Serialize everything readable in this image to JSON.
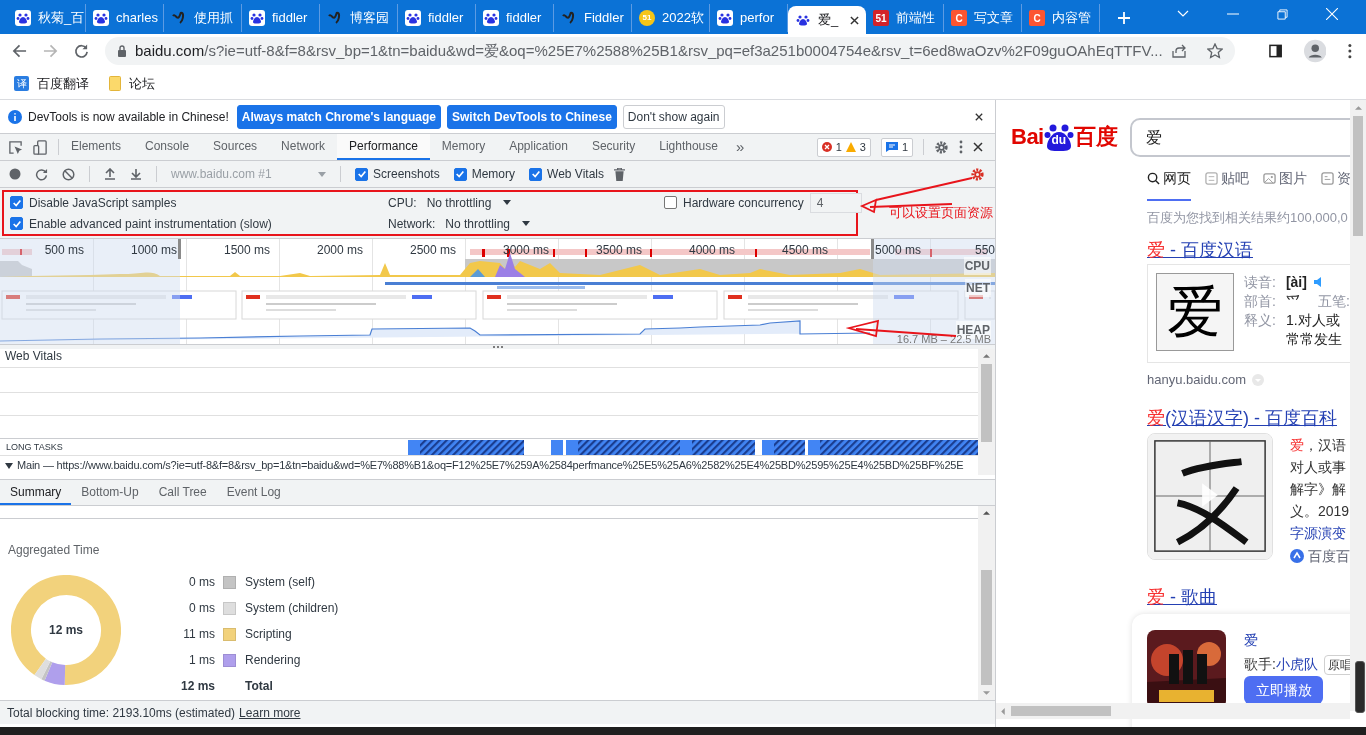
{
  "browser": {
    "tabs": [
      {
        "title": "秋菊_百",
        "kind": "paw",
        "selected": false
      },
      {
        "title": "charles",
        "kind": "paw",
        "selected": false
      },
      {
        "title": "使用抓",
        "kind": "mark",
        "selected": false
      },
      {
        "title": "fiddler",
        "kind": "paw",
        "selected": false
      },
      {
        "title": "博客园",
        "kind": "mark",
        "selected": false
      },
      {
        "title": "fiddler",
        "kind": "paw",
        "selected": false
      },
      {
        "title": "fiddler",
        "kind": "paw",
        "selected": false
      },
      {
        "title": "Fiddler",
        "kind": "mark",
        "selected": false
      },
      {
        "title": "2022软",
        "kind": "coin",
        "icon_text": "51",
        "selected": false
      },
      {
        "title": "perfor",
        "kind": "paw",
        "selected": false
      },
      {
        "title": "爱_",
        "kind": "paw",
        "selected": true
      },
      {
        "title": "前端性",
        "kind": "square",
        "icon_text": "51",
        "color": "#d2232a",
        "selected": false
      },
      {
        "title": "写文章",
        "kind": "square",
        "icon_text": "C",
        "color": "#fc5531",
        "selected": false
      },
      {
        "title": "内容管",
        "kind": "square",
        "icon_text": "C",
        "color": "#fc5531",
        "selected": false
      }
    ],
    "address": {
      "host": "baidu.com",
      "path": "/s?ie=utf-8&f=8&rsv_bp=1&tn=baidu&wd=爱&oq=%25E7%2588%25B1&rsv_pq=ef3a251b0004754e&rsv_t=6ed8waOzv%2F09guOAhEqTTFV..."
    },
    "bookmarks": [
      {
        "label": "百度翻译",
        "kind": "translate",
        "icon_text": "译"
      },
      {
        "label": "论坛",
        "kind": "folder"
      }
    ]
  },
  "devtools": {
    "infobar": {
      "message": "DevTools is now available in Chinese!",
      "buttons": [
        {
          "label": "Always match Chrome's language",
          "kind": "primary"
        },
        {
          "label": "Switch DevTools to Chinese",
          "kind": "primary"
        },
        {
          "label": "Don't show again",
          "kind": "plain"
        }
      ]
    },
    "panel_tabs": [
      {
        "label": "Elements",
        "selected": false
      },
      {
        "label": "Console",
        "selected": false
      },
      {
        "label": "Sources",
        "selected": false
      },
      {
        "label": "Network",
        "selected": false
      },
      {
        "label": "Performance",
        "selected": true
      },
      {
        "label": "Memory",
        "selected": false
      },
      {
        "label": "Application",
        "selected": false
      },
      {
        "label": "Security",
        "selected": false
      },
      {
        "label": "Lighthouse",
        "selected": false
      }
    ],
    "more_tabs": "»",
    "counts": {
      "errors": "1",
      "warnings": "3",
      "messages": "1"
    },
    "toolbar": {
      "target": "www.baidu.com #1",
      "checkboxes": [
        {
          "label": "Screenshots",
          "checked": true
        },
        {
          "label": "Memory",
          "checked": true
        },
        {
          "label": "Web Vitals",
          "checked": true
        }
      ]
    },
    "settings": {
      "checkboxes": [
        {
          "label": "Disable JavaScript samples",
          "checked": true
        },
        {
          "label": "Enable advanced paint instrumentation (slow)",
          "checked": true
        }
      ],
      "cpu": {
        "label": "CPU:",
        "value": "No throttling"
      },
      "network": {
        "label": "Network:",
        "value": "No throttling"
      },
      "hardware": {
        "label": "Hardware concurrency",
        "checked": false,
        "value": "4"
      }
    },
    "overview": {
      "ticks": [
        "500 ms",
        "1000 ms",
        "1500 ms",
        "2000 ms",
        "2500 ms",
        "3000 ms",
        "3500 ms",
        "4000 ms",
        "4500 ms",
        "5000 ms",
        "550"
      ],
      "tracks": [
        "CPU",
        "NET",
        "HEAP"
      ],
      "heap_range": "16.7 MB – 22.5 MB"
    },
    "web_vitals_label": "Web Vitals",
    "long_tasks_label": "LONG TASKS",
    "main_row": "Main — https://www.baidu.com/s?ie=utf-8&f=8&rsv_bp=1&tn=baidu&wd=%E7%88%B1&oq=F12%25E7%259A%2584perfmance%25E5%25A6%2582%25E4%25BD%2595%25E4%25BD%25BF%25E",
    "bottom_tabs": [
      {
        "label": "Summary",
        "selected": true
      },
      {
        "label": "Bottom-Up",
        "selected": false
      },
      {
        "label": "Call Tree",
        "selected": false
      },
      {
        "label": "Event Log",
        "selected": false
      }
    ],
    "summary": {
      "title": "Aggregated Time",
      "center": "12 ms",
      "legend": [
        {
          "value": "0 ms",
          "label": "System (self)",
          "color": "#c4c4c4"
        },
        {
          "value": "0 ms",
          "label": "System (children)",
          "color": "#dedede"
        },
        {
          "value": "11 ms",
          "label": "Scripting",
          "color": "#f2d27c"
        },
        {
          "value": "1 ms",
          "label": "Rendering",
          "color": "#af9fec"
        }
      ],
      "total": {
        "value": "12 ms",
        "label": "Total"
      }
    },
    "status": {
      "text": "Total blocking time: 2193.10ms (estimated)",
      "link": "Learn more"
    }
  },
  "annotation": {
    "note": "可以设置页面资源"
  },
  "page": {
    "logo": {
      "left": "Bai",
      "paw": "du",
      "right": "百度"
    },
    "search_value": "爱",
    "nav": [
      {
        "label": "网页",
        "selected": true
      },
      {
        "label": "贴吧",
        "selected": false
      },
      {
        "label": "图片",
        "selected": false
      },
      {
        "label": "资",
        "selected": false
      }
    ],
    "result_count": "百度为您找到相关结果约100,000,0",
    "results": [
      {
        "kind": "dict",
        "title_hl": "爱",
        "title_rest": " - 百度汉语",
        "char": "爱",
        "rows": [
          {
            "label": "读音:",
            "value": "[ài]"
          },
          {
            "label": "部首:",
            "value": "爫"
          },
          {
            "label": "释义:",
            "value": "1.对人或"
          }
        ],
        "extra_label": "五笔:",
        "extra_line": "常常发生",
        "source": "hanyu.baidu.com"
      },
      {
        "kind": "baike",
        "title_hl": "爱",
        "title_rest": "(汉语汉字) - 百度百科",
        "lines": [
          {
            "hl": "爱",
            "text": "，汉语"
          },
          {
            "text": "对人或事"
          },
          {
            "text": "解字》解"
          },
          {
            "text": "义。2019"
          }
        ],
        "link": "字源演变",
        "source": "百度百"
      },
      {
        "kind": "song",
        "title_hl": "爱",
        "title_rest": " - 歌曲",
        "song": "爱",
        "singer_label": "歌手:",
        "singer": "小虎队",
        "tag": "原唱",
        "button": "立即播放"
      }
    ]
  }
}
